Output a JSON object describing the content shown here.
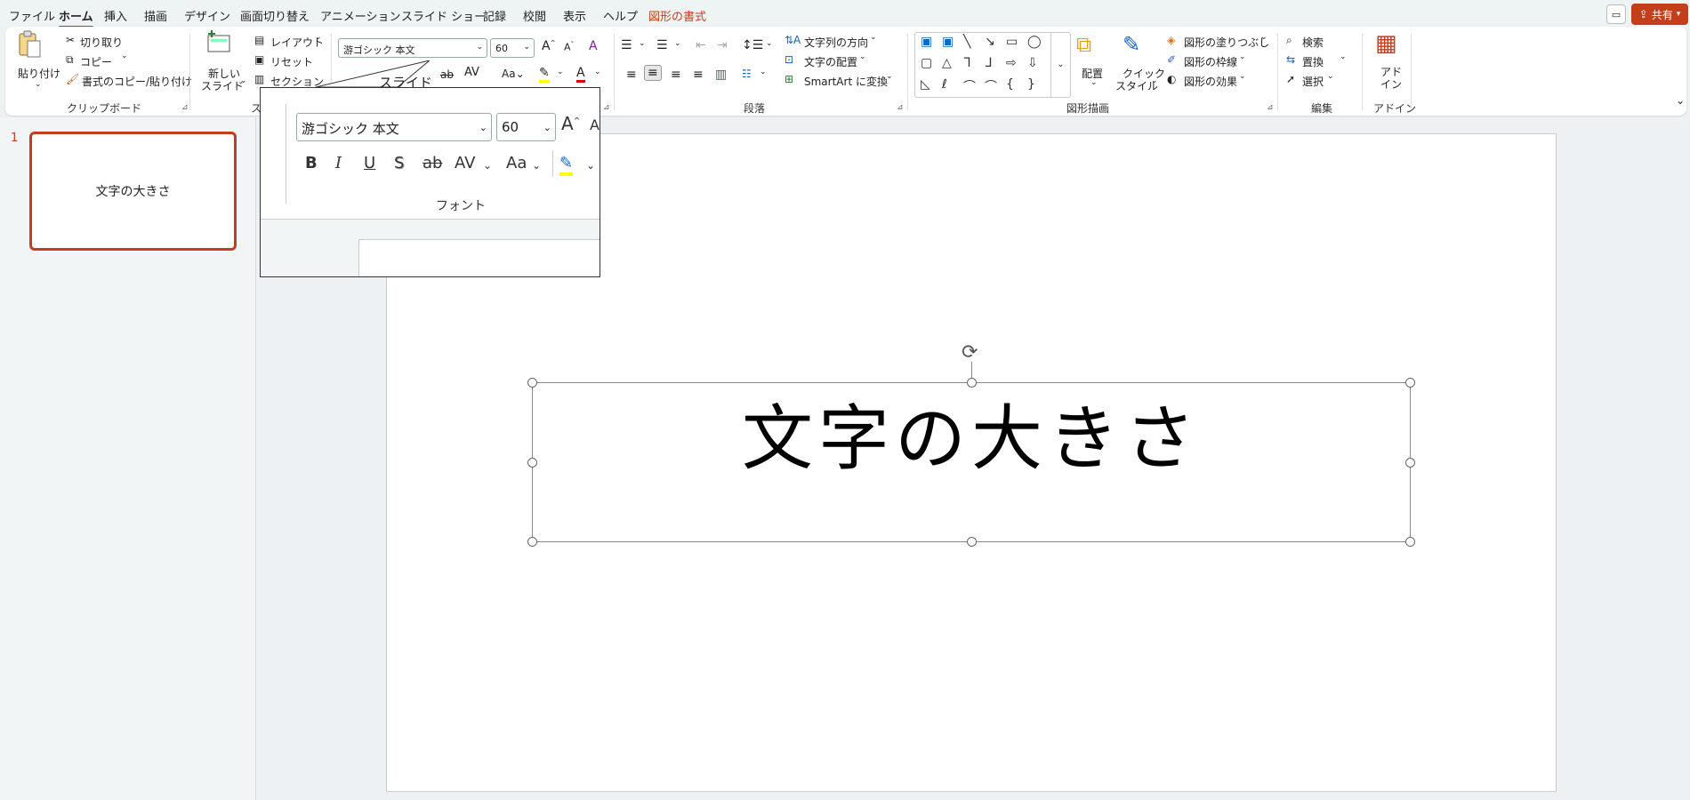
{
  "menu": {
    "tabs": [
      {
        "label": "ファイル"
      },
      {
        "label": "ホーム"
      },
      {
        "label": "挿入"
      },
      {
        "label": "描画"
      },
      {
        "label": "デザイン"
      },
      {
        "label": "画面切り替え"
      },
      {
        "label": "アニメーション"
      },
      {
        "label": "スライド ショー"
      },
      {
        "label": "記録"
      },
      {
        "label": "校閲"
      },
      {
        "label": "表示"
      },
      {
        "label": "ヘルプ"
      },
      {
        "label": "図形の書式"
      }
    ],
    "share_label": "共有"
  },
  "ribbon": {
    "clipboard": {
      "paste": "貼り付け",
      "cut": "切り取り",
      "copy": "コピー",
      "format_painter": "書式のコピー/貼り付け",
      "group_label": "クリップボード"
    },
    "slides": {
      "new_slide_1": "新しい",
      "new_slide_2": "スライド",
      "layout": "レイアウト",
      "reset": "リセット",
      "section": "セクション",
      "group_label": "スラ"
    },
    "font": {
      "font_name": "游ゴシック 本文",
      "font_size": "60",
      "group_label": "フォント",
      "hidden_label": "スライド"
    },
    "paragraph": {
      "text_direction": "文字列の方向",
      "align_text": "文字の配置",
      "smartart": "SmartArt に変換",
      "group_label": "段落"
    },
    "drawing": {
      "arrange": "配置",
      "quick_styles_1": "クイック",
      "quick_styles_2": "スタイル",
      "shape_fill": "図形の塗りつぶし",
      "shape_outline": "図形の枠線",
      "shape_effects": "図形の効果",
      "group_label": "図形描画"
    },
    "editing": {
      "find": "検索",
      "replace": "置換",
      "select": "選択",
      "group_label": "編集"
    },
    "addins": {
      "label_1": "アド",
      "label_2": "イン",
      "group_label": "アドイン"
    }
  },
  "thumbnails": [
    {
      "number": "1",
      "text": "文字の大きさ"
    }
  ],
  "slide": {
    "title": "文字の大きさ"
  },
  "colors": {
    "accent": "#c43e1c",
    "highlight": "#ffff00",
    "font_color": "#e00000"
  }
}
